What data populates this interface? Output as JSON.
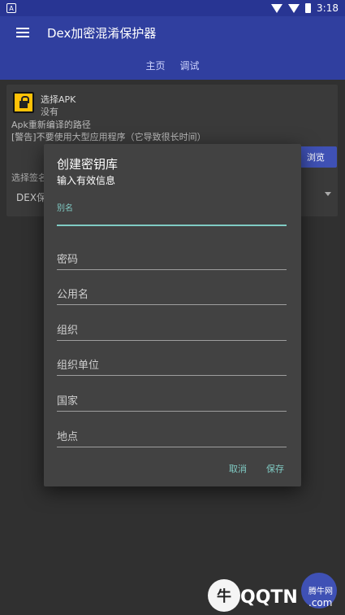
{
  "status": {
    "time": "3:18"
  },
  "appbar": {
    "title": "Dex加密混淆保护器",
    "tabs": [
      "主页",
      "调试"
    ]
  },
  "panel": {
    "apk_title": "选择APK",
    "apk_value": "没有",
    "recompile_path": "Apk重新编译的路径",
    "warning": "[警告]不要使用大型应用程序（它导致很长时间）",
    "browse_label": "浏览",
    "signature_label": "选择签名",
    "dex_value": "DEX保"
  },
  "dialog": {
    "title": "创建密钥库",
    "subtitle": "输入有效信息",
    "fields": {
      "alias": "别名",
      "password": "密码",
      "common_name": "公用名",
      "organization": "组织",
      "org_unit": "组织单位",
      "country": "国家",
      "locality": "地点"
    },
    "cancel": "取消",
    "save": "保存"
  },
  "watermark": {
    "text": "QQTN",
    "cn": "腾牛网",
    "suffix": ".com"
  }
}
